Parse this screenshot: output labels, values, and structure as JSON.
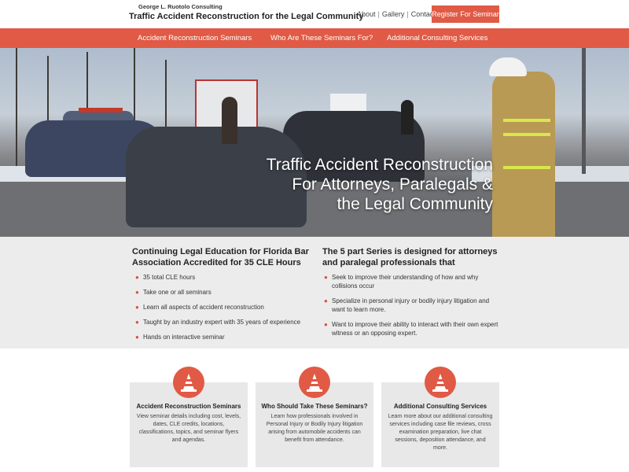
{
  "header": {
    "brand_small": "George L. Ruotolo Consulting",
    "brand_main": "Traffic Accident Reconstruction for the Legal Community",
    "links": [
      "About",
      "Gallery",
      "Contact"
    ],
    "link_separator": "|",
    "register_label": "Register For Seminar"
  },
  "nav": {
    "items": [
      "Accident Reconstruction Seminars",
      "Who Are These Seminars For?",
      "Additional Consulting Services"
    ]
  },
  "hero": {
    "lines": [
      "Traffic Accident Reconstruction",
      "For Attorneys, Paralegals &",
      "the Legal Community"
    ]
  },
  "info": {
    "left": {
      "title": "Continuing Legal Education for Florida Bar Association Accredited for 35 CLE Hours",
      "bullets": [
        "35 total CLE hours",
        "Take one or all seminars",
        "Learn all aspects of accident reconstruction",
        "Taught by an industry expert with 35 years of experience",
        "Hands on interactive seminar"
      ]
    },
    "right": {
      "title": "The 5 part Series is designed for attorneys and paralegal professionals that",
      "bullets": [
        "Seek to improve their understanding of how and why collisions occur",
        "Specialize in personal injury or bodily injury litigation and want to learn more.",
        "Want to improve their ability to interact with their own expert witness or an opposing expert."
      ]
    },
    "bullet_glyph": "●"
  },
  "cards": [
    {
      "title": "Accident Reconstruction Seminars",
      "text": "View seminar details including cost, levels, dates, CLE credits, locations, classifications, topics, and seminar flyers and agendas."
    },
    {
      "title": "Who Should Take These Seminars?",
      "text": "Learn how professionals involved in Personal Injury or Bodily Injury litigation arising from automobile accidents can benefit from attendance."
    },
    {
      "title": "Additional Consulting Services",
      "text": "Learn more about our additional consulting services including case file reviews, cross examination preparation, live chat sessions, deposition attendance, and more."
    }
  ],
  "colors": {
    "accent": "#e05a45",
    "info_band": "#ececec",
    "card_bg": "#e8e8e8"
  },
  "icons": {
    "card_icon": "traffic-cone-icon"
  }
}
